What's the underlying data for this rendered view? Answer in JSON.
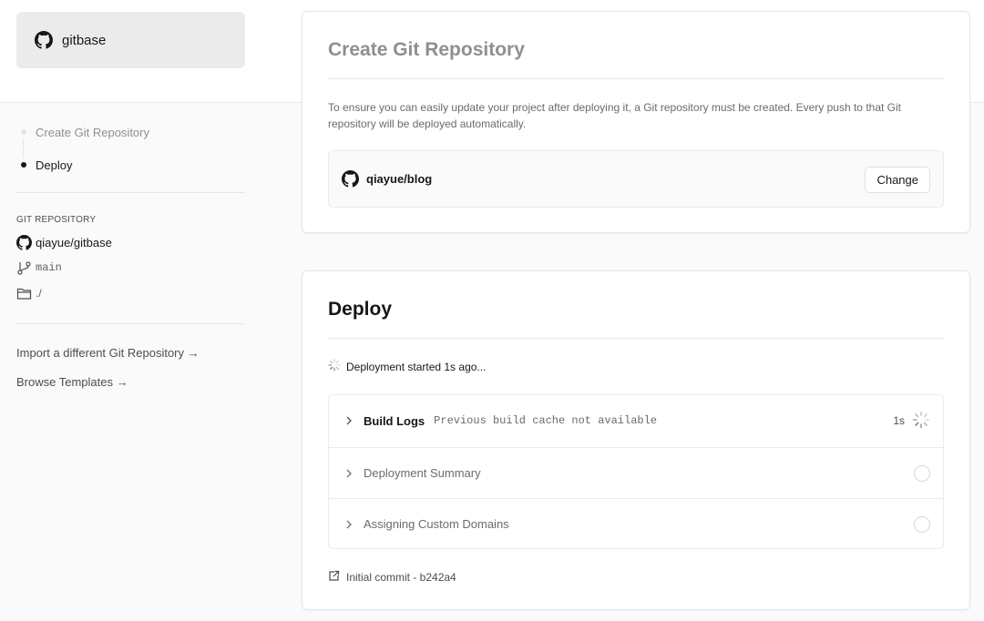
{
  "project": {
    "name": "gitbase",
    "icon": "github-icon"
  },
  "steps": [
    {
      "label": "Create Git Repository",
      "state": "done"
    },
    {
      "label": "Deploy",
      "state": "active"
    }
  ],
  "repo_info": {
    "section_title": "GIT REPOSITORY",
    "repo": "qiayue/gitbase",
    "branch": "main",
    "directory": "./"
  },
  "links": {
    "import": "Import a different Git Repository →",
    "templates": "Browse Templates →"
  },
  "create_card": {
    "title": "Create Git Repository",
    "description": "To ensure you can easily update your project after deploying it, a Git repository must be created. Every push to that Git repository will be deployed automatically.",
    "repo": "qiayue/blog",
    "change_label": "Change"
  },
  "deploy_card": {
    "title": "Deploy",
    "status": "Deployment started 1s ago...",
    "rows": [
      {
        "label": "Build Logs",
        "sub": "Previous build cache not available",
        "time": "1s",
        "state": "running"
      },
      {
        "label": "Deployment Summary",
        "state": "pending"
      },
      {
        "label": "Assigning Custom Domains",
        "state": "pending"
      }
    ],
    "commit": "Initial commit - b242a4"
  },
  "colors": {
    "accent": "#171717",
    "muted": "#8f8f8f",
    "border": "#e5e5e5"
  }
}
